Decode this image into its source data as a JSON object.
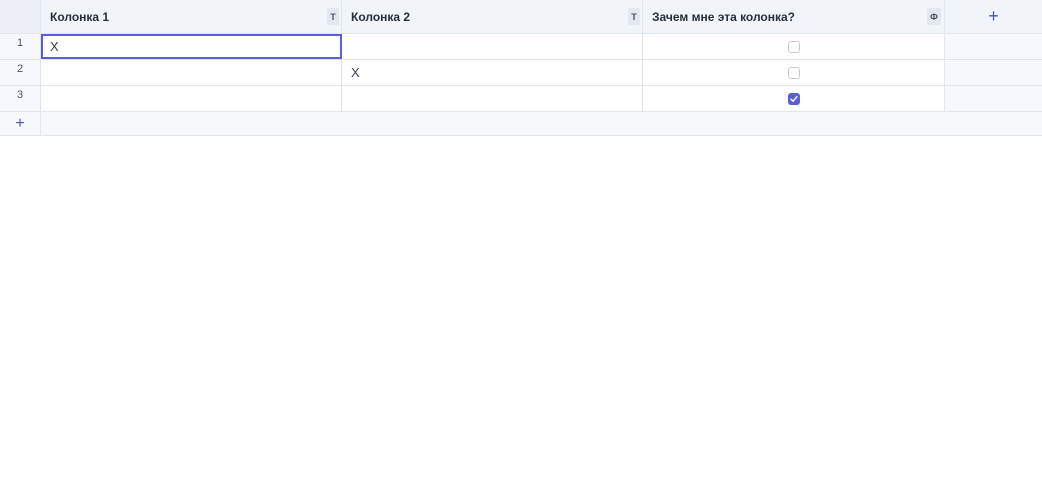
{
  "columns": [
    {
      "title": "Колонка 1",
      "type_badge": "T"
    },
    {
      "title": "Колонка 2",
      "type_badge": "T"
    },
    {
      "title": "Зачем мне эта колонка?",
      "type_badge": "Ф"
    }
  ],
  "add_column_label": "+",
  "add_row_label": "+",
  "rows": [
    {
      "num": "1",
      "col1": "X",
      "col2": "",
      "checked": false
    },
    {
      "num": "2",
      "col1": "",
      "col2": "X",
      "checked": false
    },
    {
      "num": "3",
      "col1": "",
      "col2": "",
      "checked": true
    }
  ],
  "colors": {
    "accent": "#5b5fd6",
    "header_bg": "#f1f4f9",
    "border": "#e1e5ec"
  }
}
